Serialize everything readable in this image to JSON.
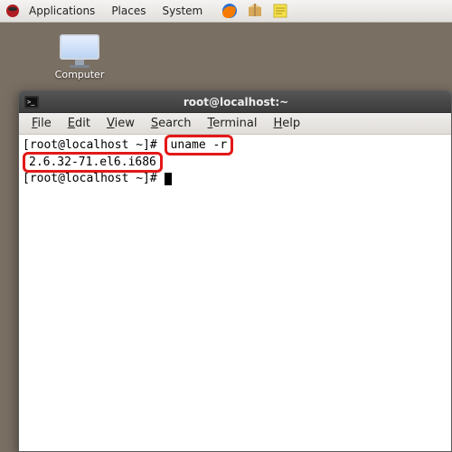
{
  "panel": {
    "menus": [
      "Applications",
      "Places",
      "System"
    ],
    "tray_icons": [
      "firefox-icon",
      "package-icon",
      "note-icon"
    ]
  },
  "desktop": {
    "computer_label": "Computer"
  },
  "terminal": {
    "title": "root@localhost:~",
    "menus": {
      "file": "File",
      "edit": "Edit",
      "view": "View",
      "search": "Search",
      "terminal_menu": "Terminal",
      "help": "Help"
    },
    "lines": {
      "prompt1_prefix": "[root@localhost ~]#",
      "command1": "uname -r",
      "blank": "",
      "output1": "2.6.32-71.el6.i686",
      "prompt2": "[root@localhost ~]#"
    }
  }
}
